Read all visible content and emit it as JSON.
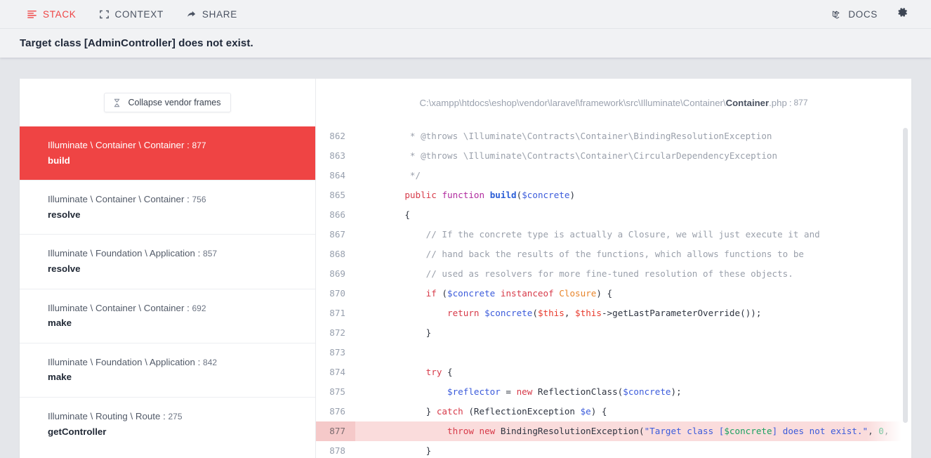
{
  "toolbar": {
    "items": [
      {
        "label": "STACK",
        "icon": "stack-icon",
        "active": true
      },
      {
        "label": "CONTEXT",
        "icon": "context-icon",
        "active": false
      },
      {
        "label": "SHARE",
        "icon": "share-icon",
        "active": false
      }
    ],
    "docs_label": "DOCS",
    "docs_icon": "laravel-logo-icon",
    "settings_icon": "gear-icon"
  },
  "error": {
    "title": "Target class [AdminController] does not exist."
  },
  "frames_panel": {
    "collapse_label": "Collapse vendor frames",
    "collapse_icon": "collapse-icon",
    "frames": [
      {
        "class": "Illuminate \\ Container \\ Container",
        "line": "877",
        "method": "build",
        "selected": true
      },
      {
        "class": "Illuminate \\ Container \\ Container",
        "line": "756",
        "method": "resolve",
        "selected": false
      },
      {
        "class": "Illuminate \\ Foundation \\ Application",
        "line": "857",
        "method": "resolve",
        "selected": false
      },
      {
        "class": "Illuminate \\ Container \\ Container",
        "line": "692",
        "method": "make",
        "selected": false
      },
      {
        "class": "Illuminate \\ Foundation \\ Application",
        "line": "842",
        "method": "make",
        "selected": false
      },
      {
        "class": "Illuminate \\ Routing \\ Route",
        "line": "275",
        "method": "getController",
        "selected": false
      }
    ]
  },
  "code_panel": {
    "file_dir": "C:\\xampp\\htdocs\\eshop\\vendor\\laravel\\framework\\src\\Illuminate\\Container\\",
    "file_name": "Container",
    "file_ext": ".php",
    "file_line": "877",
    "path_separator": ":",
    "highlighted_line": "877",
    "lines": [
      {
        "no": "862",
        "text": "     * @throws \\Illuminate\\Contracts\\Container\\BindingResolutionException"
      },
      {
        "no": "863",
        "text": "     * @throws \\Illuminate\\Contracts\\Container\\CircularDependencyException"
      },
      {
        "no": "864",
        "text": "     */"
      },
      {
        "no": "865",
        "text": "    public function build($concrete)"
      },
      {
        "no": "866",
        "text": "    {"
      },
      {
        "no": "867",
        "text": "        // If the concrete type is actually a Closure, we will just execute it and"
      },
      {
        "no": "868",
        "text": "        // hand back the results of the functions, which allows functions to be"
      },
      {
        "no": "869",
        "text": "        // used as resolvers for more fine-tuned resolution of these objects."
      },
      {
        "no": "870",
        "text": "        if ($concrete instanceof Closure) {"
      },
      {
        "no": "871",
        "text": "            return $concrete($this, $this->getLastParameterOverride());"
      },
      {
        "no": "872",
        "text": "        }"
      },
      {
        "no": "873",
        "text": ""
      },
      {
        "no": "874",
        "text": "        try {"
      },
      {
        "no": "875",
        "text": "            $reflector = new ReflectionClass($concrete);"
      },
      {
        "no": "876",
        "text": "        } catch (ReflectionException $e) {"
      },
      {
        "no": "877",
        "text": "            throw new BindingResolutionException(\"Target class [$concrete] does not exist.\", 0,"
      },
      {
        "no": "878",
        "text": "        }"
      }
    ]
  },
  "colors": {
    "accent_red": "#ef4444",
    "page_bg": "#e4e6ea",
    "header_bg": "#f1f2f4",
    "highlight_line_bg": "#fadcdc"
  }
}
